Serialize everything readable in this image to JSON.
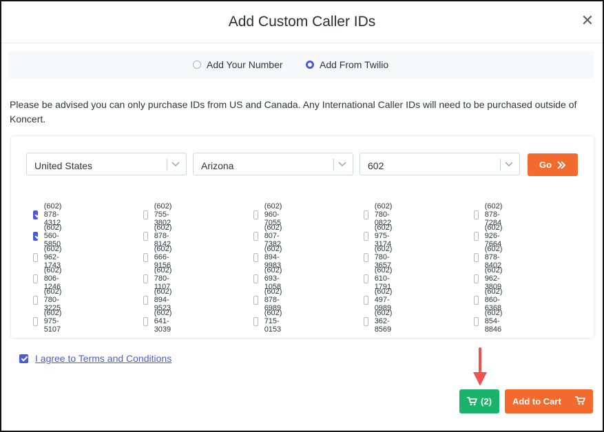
{
  "dialog": {
    "title": "Add Custom Caller IDs"
  },
  "mode": {
    "options": [
      {
        "label": "Add Your Number",
        "selected": false
      },
      {
        "label": "Add From Twilio",
        "selected": true
      }
    ]
  },
  "notice": "Please be advised you can only purchase IDs from US and Canada. Any International Caller IDs will need to be purchased outside of Koncert.",
  "filters": {
    "country": "United States",
    "state": "Arizona",
    "area_code": "602",
    "go_label": "Go"
  },
  "numbers": [
    [
      "(602) 878-4312",
      "(602) 755-3802",
      "(602) 960-7055",
      "(602) 780-0822",
      "(602) 878-7284"
    ],
    [
      "(602) 560-5850",
      "(602) 878-8142",
      "(602) 807-7382",
      "(602) 975-3174",
      "(602) 926-7664"
    ],
    [
      "(602) 962-1743",
      "(602) 666-9156",
      "(602) 894-9983",
      "(602) 780-3657",
      "(602) 878-8402"
    ],
    [
      "(602) 806-1246",
      "(602) 780-1107",
      "(602) 693-1058",
      "(602) 610-1791",
      "(602) 962-3809"
    ],
    [
      "(602) 780-3225",
      "(602) 894-9523",
      "(602) 878-6989",
      "(602) 497-0989",
      "(602) 860-6368"
    ],
    [
      "(602) 975-5107",
      "(602) 641-3039",
      "(602) 715-0153",
      "(602) 362-8569",
      "(602) 854-8846"
    ]
  ],
  "selected_numbers": [
    "(602) 878-4312",
    "(602) 560-5850"
  ],
  "terms": {
    "label": "I agree to Terms and Conditions",
    "checked": true
  },
  "cart": {
    "count_label": "(2)"
  },
  "add_to_cart": {
    "label": "Add to Cart"
  },
  "colors": {
    "accent": "#4b5bd6",
    "primary_orange": "#f26a2e",
    "cart_green": "#1bb36b",
    "annotation_arrow": "#ef5350"
  }
}
